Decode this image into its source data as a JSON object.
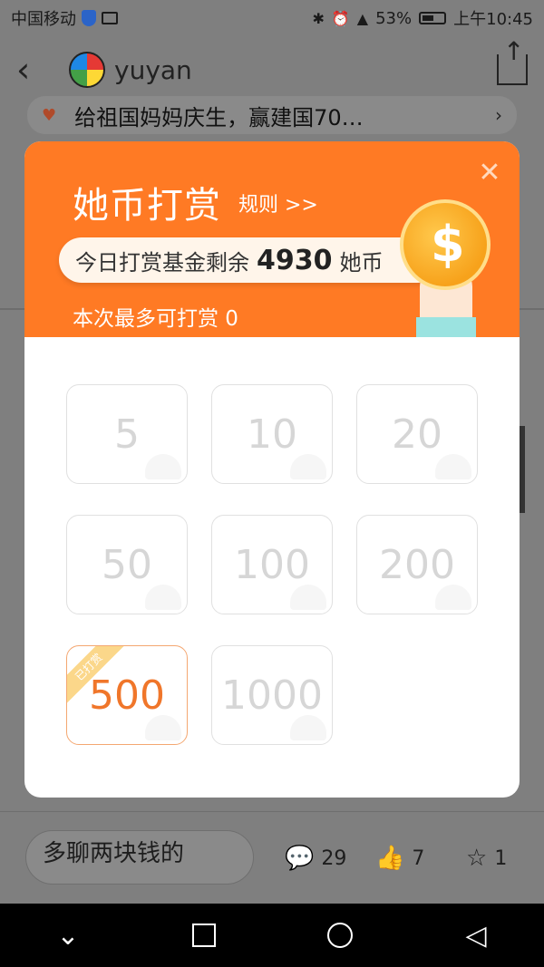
{
  "status_bar": {
    "carrier": "中国移动",
    "battery": "53%",
    "time": "上午10:45",
    "icons": [
      "shield-icon",
      "pulse-icon",
      "bluetooth-icon",
      "alarm-icon",
      "hd-icon",
      "4g-icon",
      "signal-icon",
      "battery-icon"
    ]
  },
  "header": {
    "back_icon": "chevron-left-icon",
    "username": "yuyan",
    "share_icon": "share-icon"
  },
  "banner": {
    "text": "给祖国妈妈庆生，赢建国70…"
  },
  "modal": {
    "title": "她币打赏",
    "rule_link": "规则 >>",
    "fund_label": "今日打赏基金剩余",
    "fund_amount": "4930",
    "fund_unit": "她币",
    "limit_text": "本次最多可打赏 0",
    "options": [
      {
        "value": "5",
        "selected": false
      },
      {
        "value": "10",
        "selected": false
      },
      {
        "value": "20",
        "selected": false
      },
      {
        "value": "50",
        "selected": false
      },
      {
        "value": "100",
        "selected": false
      },
      {
        "value": "200",
        "selected": false
      },
      {
        "value": "500",
        "selected": true,
        "ribbon": "已打赏"
      },
      {
        "value": "1000",
        "selected": false
      }
    ],
    "accent_color": "#ff7a24"
  },
  "bottom_bar": {
    "comment_placeholder": "多聊两块钱的",
    "comments_count": "29",
    "likes_count": "7",
    "favorites_count": "1"
  }
}
